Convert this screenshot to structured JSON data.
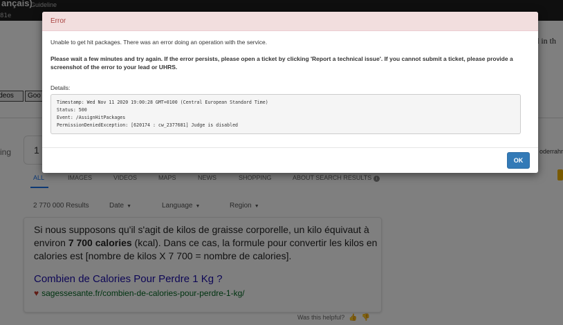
{
  "header": {
    "title": "ançais)",
    "guideline_link": "Guideline",
    "hash_fragment": "81e"
  },
  "page": {
    "right_cut_text": "ed in th",
    "chips": [
      "ideos",
      "Goo"
    ],
    "side_label": "ing",
    "search_value": "1",
    "right_cut_label": "oderrahr",
    "tabs": [
      {
        "label": "ALL",
        "active": true
      },
      {
        "label": "IMAGES",
        "active": false
      },
      {
        "label": "VIDEOS",
        "active": false
      },
      {
        "label": "MAPS",
        "active": false
      },
      {
        "label": "NEWS",
        "active": false
      },
      {
        "label": "SHOPPING",
        "active": false
      },
      {
        "label": "ABOUT SEARCH RESULTS",
        "active": false
      }
    ],
    "result_count": "2 770 000 Results",
    "filters": [
      "Date",
      "Language",
      "Region"
    ],
    "card": {
      "snippet_before": "Si nous supposons qu'il s'agit de kilos de graisse corporelle, un kilo équivaut à environ ",
      "snippet_bold": "7 700 calories",
      "snippet_after": " (kcal). Dans ce cas, la formule pour convertir les kilos en calories est [nombre de kilos X 7 700 = nombre de calories].",
      "link_title": "Combien de Calories Pour Perdre 1 Kg ?",
      "url": "sagessesante.fr/combien-de-calories-pour-perdre-1-kg/"
    },
    "helpful_text": "Was this helpful?"
  },
  "modal": {
    "title": "Error",
    "message": "Unable to get hit packages. There was an error doing an operation with the service.",
    "instructions": "Please wait a few minutes and try again. If the error persists, please open a ticket by clicking 'Report a technical issue'. If you cannot submit a ticket, please provide a screenshot of the error to your lead or UHRS.",
    "details_label": "Details:",
    "details_lines": [
      "Timestamp: Wed Nov 11 2020 19:00:28 GMT+0100 (Central European Standard Time)",
      "Status: 500",
      "Event: /AssignHitPackages",
      "PermissionDeniedException: [620174 : cw_2377681] Judge is disabled"
    ],
    "ok_label": "OK"
  },
  "colors": {
    "error_header_bg": "#f2dede",
    "error_header_text": "#a94442",
    "primary_button": "#337ab7",
    "link": "#1a0dab",
    "url": "#006621"
  }
}
